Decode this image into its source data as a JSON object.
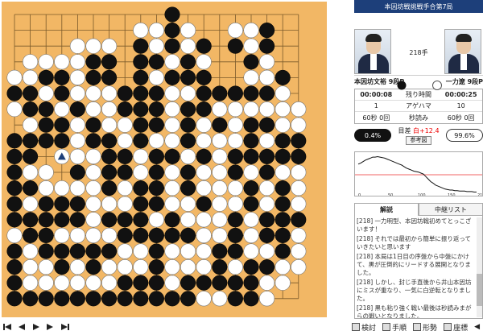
{
  "header": {
    "title": "本因坊戦挑戦手合第7局"
  },
  "players": {
    "black": {
      "name": "本因坊文裕 9段P",
      "time_left": "00:00:08",
      "captures": "1",
      "byoyomi": "60秒 0回"
    },
    "white": {
      "name": "一力遼 9段P",
      "time_left": "00:00:25",
      "captures": "10",
      "byoyomi": "60秒 0回"
    },
    "move_number": "218手",
    "labels": {
      "time_left": "残り時間",
      "captures": "アゲハマ",
      "byoyomi": "秒読み"
    }
  },
  "winrate": {
    "black": "0.4%",
    "white": "99.6%",
    "black_value": 0.4,
    "white_value": 99.6
  },
  "estimate": {
    "label": "目差",
    "value": "白+12.4",
    "reference_button": "参考図"
  },
  "graph": {
    "x_ticks": [
      "0",
      "50",
      "100",
      "150",
      "218"
    ]
  },
  "tabs": [
    {
      "label": "解説",
      "active": true
    },
    {
      "label": "中継リスト",
      "active": false
    }
  ],
  "comments": [
    "[218] 一力明型、本因坊戦初めてとっこざいます！",
    "[218] それでは最初から簡単に振り返っていきたいと思います",
    "[218] 本局は1日目の序盤から中盤にかけて、黒が圧倒的にリードする展開となりました。",
    "[218] しかし、封じ手直後から井山本因坊にミスが重なり、一気に白逆転となりました。",
    "[218] 黒も粘り強く戦い最後は秒読みまがらの戦いとなりました。",
    "[218] そこで白の一力挑戦者の正確な着手は圧巻のうち四目となりそのまま白が勝ち切ってしまいました"
  ],
  "toolbar": {
    "nav": [
      "first",
      "prev",
      "play",
      "next",
      "last"
    ],
    "tools": [
      {
        "label": "検討",
        "icon": "grid-icon"
      },
      {
        "label": "手順",
        "icon": "list-icon"
      },
      {
        "label": "形勢",
        "icon": "chart-icon"
      },
      {
        "label": "座標",
        "icon": "coordinate-icon"
      }
    ]
  },
  "board": {
    "size": 19,
    "last_move_marker": "triangle",
    "rows": [
      "..........B........",
      "........WWBW..WWB..",
      "....WWW.BWBWB.BWB..",
      ".WWWWBB.BBWBW..BW..",
      "WWBBWBB.BWBBB..WWB.",
      "BBWBWWWBBBWWBBBBBW.",
      "WBBWBWWBBBWBBWWWWWW",
      ".WBBWBWWBBWBWBWBBWW",
      "BBBBWBBWBWWBWWWBWBB",
      "BB..WWBBWBBWBWBBBBB",
      "BWW.BWBBWBWBWWBWBWW",
      "BBWWWWBWBBWBWWWBWBW",
      "BWBBBWWWBBWWBWWBWBW",
      "BBBBBWBBBWBWWWBWBBB",
      "WBBWWWWBBBBBWWBWBBW",
      "BWBBBBBWWBWWWBBWWBW",
      "BWWBWBWWWBWWWBWBBWW",
      "BWWWWWWBBBWBBBBBWW.",
      "BBBBBBBBBBBBWWBBW.."
    ]
  }
}
